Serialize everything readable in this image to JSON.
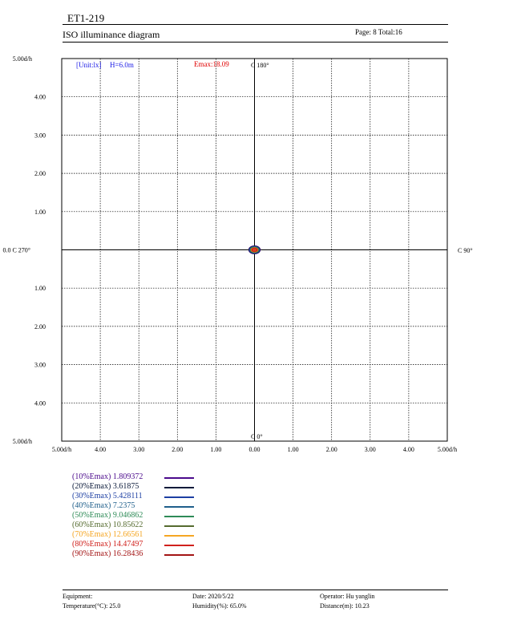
{
  "header": {
    "title": "ET1-219",
    "subtitle": "ISO illuminance diagram",
    "page_info": "Page: 8  Total:16"
  },
  "chart_data": {
    "type": "scatter",
    "unit_label": "[Unit:lx]",
    "height_label": "H=6.0m",
    "emax_label": "Emax:18.09",
    "emax": 18.09,
    "c_labels": {
      "top": "C 180°",
      "bottom": "C 0°",
      "left": "0.0 C 270°",
      "right": "C 90°"
    },
    "y_tick_labels": [
      "5.00d/h",
      "4.00",
      "3.00",
      "2.00",
      "1.00",
      "0.0 C 270°",
      "1.00",
      "2.00",
      "3.00",
      "4.00",
      "5.00d/h"
    ],
    "x_tick_labels": [
      "5.00d/h",
      "4.00",
      "3.00",
      "2.00",
      "1.00",
      "0.00",
      "1.00",
      "2.00",
      "3.00",
      "4.00",
      "5.00d/h"
    ],
    "xlim": [
      -5,
      5
    ],
    "ylim": [
      -5,
      5
    ],
    "grid": true,
    "center_point": {
      "x": 0,
      "y": 0
    },
    "isolines": [
      {
        "label": "(10%Emax) 1.809372",
        "percent": 10,
        "value": 1.809372,
        "color": "#4b0a8c"
      },
      {
        "label": "(20%Emax) 3.61875",
        "percent": 20,
        "value": 3.61875,
        "color": "#0b1a3a"
      },
      {
        "label": "(30%Emax) 5.428111",
        "percent": 30,
        "value": 5.428111,
        "color": "#1d3fa3"
      },
      {
        "label": "(40%Emax) 7.2375",
        "percent": 40,
        "value": 7.2375,
        "color": "#1f5f8b"
      },
      {
        "label": "(50%Emax) 9.046862",
        "percent": 50,
        "value": 9.046862,
        "color": "#2e8b57"
      },
      {
        "label": "(60%Emax) 10.85622",
        "percent": 60,
        "value": 10.85622,
        "color": "#556b2f"
      },
      {
        "label": "(70%Emax) 12.66561",
        "percent": 70,
        "value": 12.66561,
        "color": "#f5a623"
      },
      {
        "label": "(80%Emax) 14.47497",
        "percent": 80,
        "value": 14.47497,
        "color": "#d0211c"
      },
      {
        "label": "(90%Emax) 16.28436",
        "percent": 90,
        "value": 16.28436,
        "color": "#a31515"
      }
    ]
  },
  "footer": {
    "equipment": "Equipment:",
    "temperature": "Temperature(°C): 25.0",
    "date": "Date: 2020/5/22",
    "humidity": "Humidity(%): 65.0%",
    "operator": "Operator: Hu yanglin",
    "distance": "Distance(m): 10.23"
  }
}
